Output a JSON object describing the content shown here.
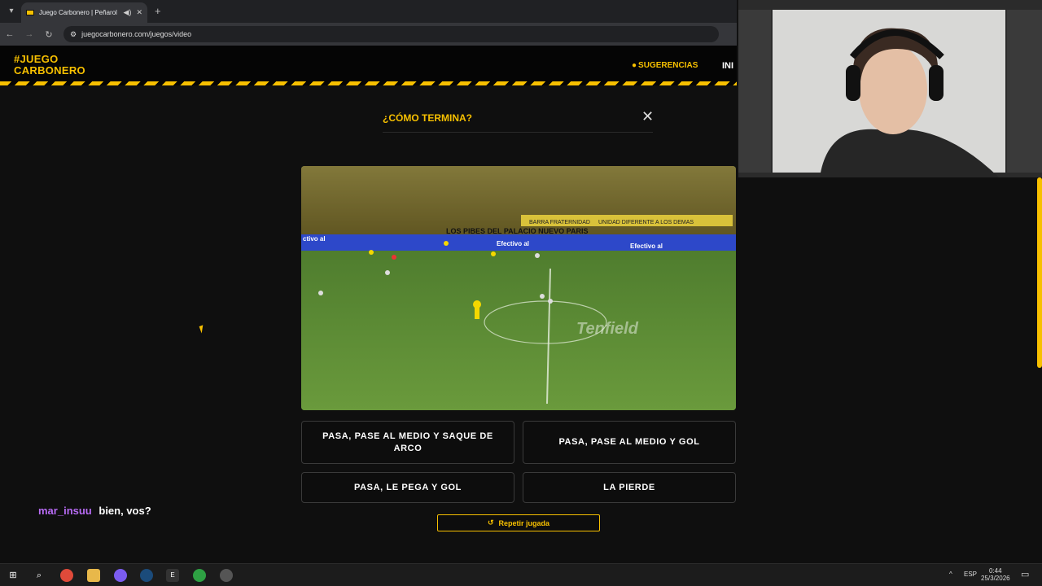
{
  "browser": {
    "tab_title": "Juego Carbonero | Peñarol",
    "url": "juegocarbonero.com/juegos/video"
  },
  "site": {
    "logo_line1": "#JUEGO",
    "logo_line2": "CARBONERO",
    "nav_sugerencias": "SUGERENCIAS",
    "nav_inicio": "INI"
  },
  "modal": {
    "title": "¿CÓMO TERMINA?",
    "video": {
      "ad_boards": [
        "ctivo al",
        "Efectivo al",
        "Efectivo al"
      ],
      "banner": "LOS PIBES DEL PALACIO NUEVO PARIS",
      "banner2": "BARRA FRATERNIDAD",
      "banner3": "UNIDAD DIFERENTE A LOS DEMAS",
      "watermark": "Tenfield"
    },
    "answers": [
      "PASA, PASE AL MEDIO Y SAQUE DE ARCO",
      "PASA, PASE AL MEDIO Y GOL",
      "PASA, LE PEGA Y GOL",
      "LA PIERDE"
    ],
    "replay_label": "Repetir jugada"
  },
  "chat": {
    "username": "mar_insuu",
    "message": "bien, vos?"
  },
  "taskbar": {
    "language": "ESP",
    "time": "0:44",
    "date": "25/3/2026"
  },
  "colors": {
    "accent": "#f7c000",
    "chat_user": "#b86bf5"
  }
}
